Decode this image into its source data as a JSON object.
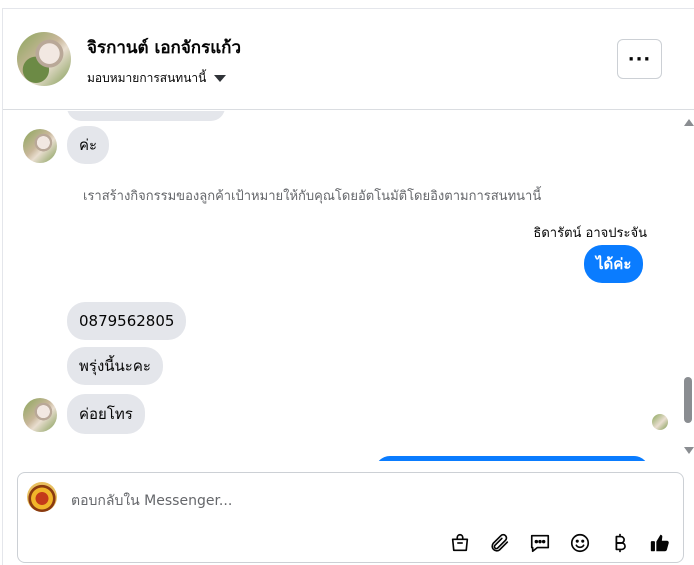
{
  "header": {
    "contact_name": "จิรกานต์ เอกจักรแก้ว",
    "assign_label": "มอบหมายการสนทนานี้",
    "more_label": "···"
  },
  "messages": [
    {
      "id": "m1",
      "direction": "in",
      "text": "ค่ะ"
    },
    {
      "id": "note",
      "type": "system",
      "text": "เราสร้างกิจกรรมของลูกค้าเป้าหมายให้กับคุณโดยอัตโนมัติโดยอิงตามการสนทนานี้"
    },
    {
      "id": "sender",
      "type": "sender_name",
      "text": "ธิดารัตน์ อาจประจัน"
    },
    {
      "id": "m2",
      "direction": "out",
      "text": "ได้ค่ะ"
    },
    {
      "id": "m3",
      "direction": "in",
      "text": "0879562805"
    },
    {
      "id": "m4",
      "direction": "in",
      "text": "พรุ่งนี้นะคะ"
    },
    {
      "id": "m5",
      "direction": "in",
      "text": "ค่อยโทร"
    }
  ],
  "composer": {
    "placeholder": "ตอบกลับใน Messenger...",
    "tools": [
      "shopping-bag-icon",
      "attach-icon",
      "saved-reply-icon",
      "emoji-icon",
      "baht-icon",
      "like-icon"
    ]
  },
  "colors": {
    "outgoing_bubble": "#0a7cff",
    "incoming_bubble": "#e4e6eb",
    "muted_text": "#65676b"
  }
}
